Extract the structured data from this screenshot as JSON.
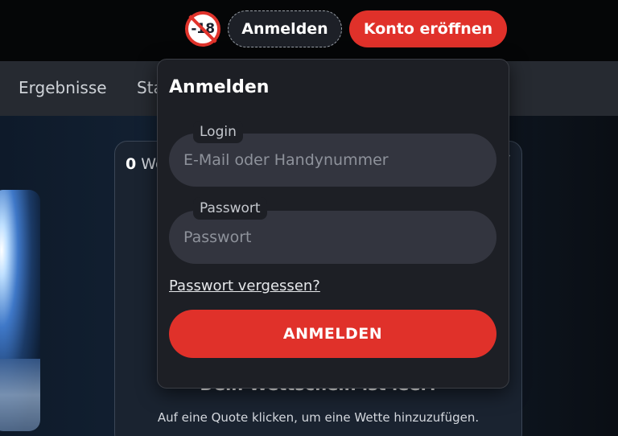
{
  "header": {
    "age_badge": "-18",
    "login_button": "Anmelden",
    "register_button": "Konto eröffnen"
  },
  "nav": {
    "items": [
      "Ergebnisse",
      "Sta"
    ]
  },
  "betslip": {
    "count": "0",
    "label_partial": "We",
    "empty_title": "Dein Wettschein ist leer!",
    "empty_subtitle": "Auf eine Quote klicken, um eine Wette hinzuzufügen."
  },
  "login_panel": {
    "title": "Anmelden",
    "login_label": "Login",
    "login_placeholder": "E-Mail oder Handynummer",
    "password_label": "Passwort",
    "password_placeholder": "Passwort",
    "forgot_link": "Passwort vergessen?",
    "submit_button": "ANMELDEN"
  },
  "colors": {
    "accent": "#e0312a",
    "panel_bg": "#1d1f25",
    "input_bg": "#33353f"
  }
}
